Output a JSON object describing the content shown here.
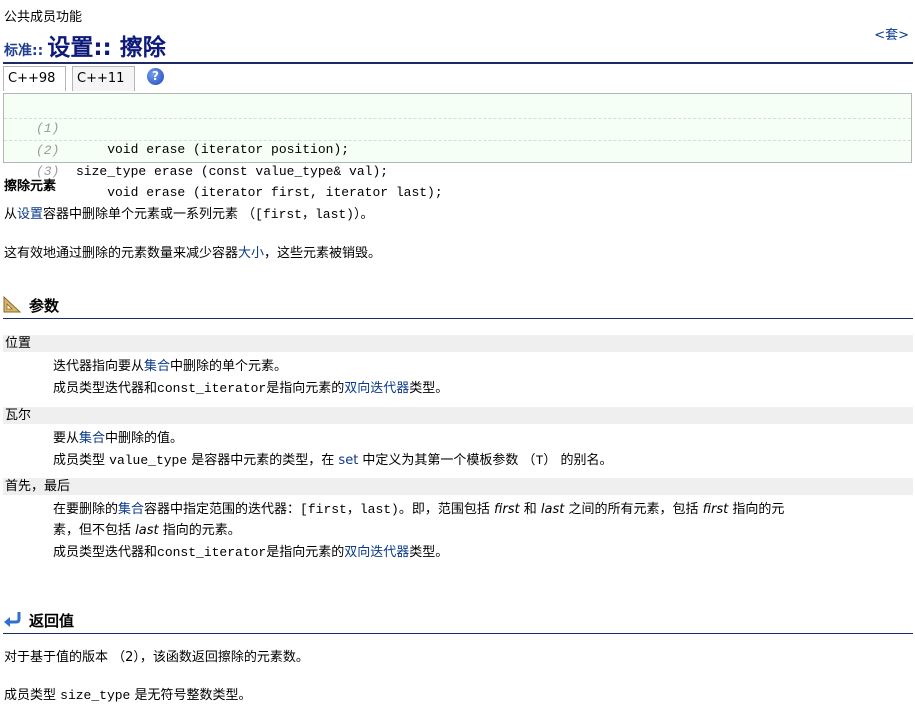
{
  "header": {
    "member_type": "公共成员功能",
    "ns_prefix": "标准::",
    "title": "设置:: 擦除",
    "set_link": "<套>"
  },
  "tabs": [
    {
      "label": "C++98"
    },
    {
      "label": "C++11"
    }
  ],
  "help_icon": "help-icon",
  "declarations": [
    {
      "num": "(1)",
      "code": "    void erase (iterator position);"
    },
    {
      "num": "(2)",
      "code": "size_type erase (const value_type& val);"
    },
    {
      "num": "(3)",
      "code": "    void erase (iterator first, iterator last);"
    }
  ],
  "section_title": "擦除元素",
  "intro": {
    "p1_a": "从",
    "p1_link": "设置",
    "p1_b": "容器中删除单个元素或一系列元素 （",
    "p1_code": "[first，last)",
    "p1_c": "）。",
    "p2_a": "这有效地通过删除的元素数量来减少容器",
    "p2_link": "大小",
    "p2_b": "，这些元素被销毁。"
  },
  "params_heading": "参数",
  "params": {
    "p1_name": "位置",
    "p1_l1_a": "迭代器指向要从",
    "p1_l1_link": "集合",
    "p1_l1_b": "中删除的单个元素。",
    "p1_l2_a": "成员类型迭代器和",
    "p1_l2_code": "const_iterator",
    "p1_l2_b": "是指向元素的",
    "p1_l2_link": "双向迭代器",
    "p1_l2_c": "类型。",
    "p2_name": "瓦尔",
    "p2_l1_a": "要从",
    "p2_l1_link": "集合",
    "p2_l1_b": "中删除的值。",
    "p2_l2_a": "成员类型 ",
    "p2_l2_code": "value_type",
    "p2_l2_b": " 是容器中元素的类型，在 ",
    "p2_l2_link": "set",
    "p2_l2_c": " 中定义为其第一个模板参数 （",
    "p2_l2_code2": "T",
    "p2_l2_d": "） 的别名。",
    "p3_name": "首先，最后",
    "p3_l1_a": "在要删除的",
    "p3_l1_link": "集合",
    "p3_l1_b": "容器中指定范围的迭代器：",
    "p3_l1_code": "[first，last)",
    "p3_l1_c": "。即，范围包括 ",
    "p3_l1_i1": "first",
    "p3_l1_d": " 和 ",
    "p3_l1_i2": "last",
    "p3_l1_e": " 之间的所有元素，包括 ",
    "p3_l1_i3": "first",
    "p3_l1_f": " 指向的元",
    "p3_l2_a": "素，但不包括 ",
    "p3_l2_i": "last",
    "p3_l2_b": " 指向的元素。",
    "p3_l3_a": "成员类型迭代器和",
    "p3_l3_code": "const_iterator",
    "p3_l3_b": "是指向元素的",
    "p3_l3_link": "双向迭代器",
    "p3_l3_c": "类型。"
  },
  "return_heading": "返回值",
  "return": {
    "r1": "对于基于值的版本 （2），该函数返回擦除的元素数。",
    "r2_a": "成员类型 ",
    "r2_code": "size_type",
    "r2_b": " 是无符号整数类型。"
  }
}
